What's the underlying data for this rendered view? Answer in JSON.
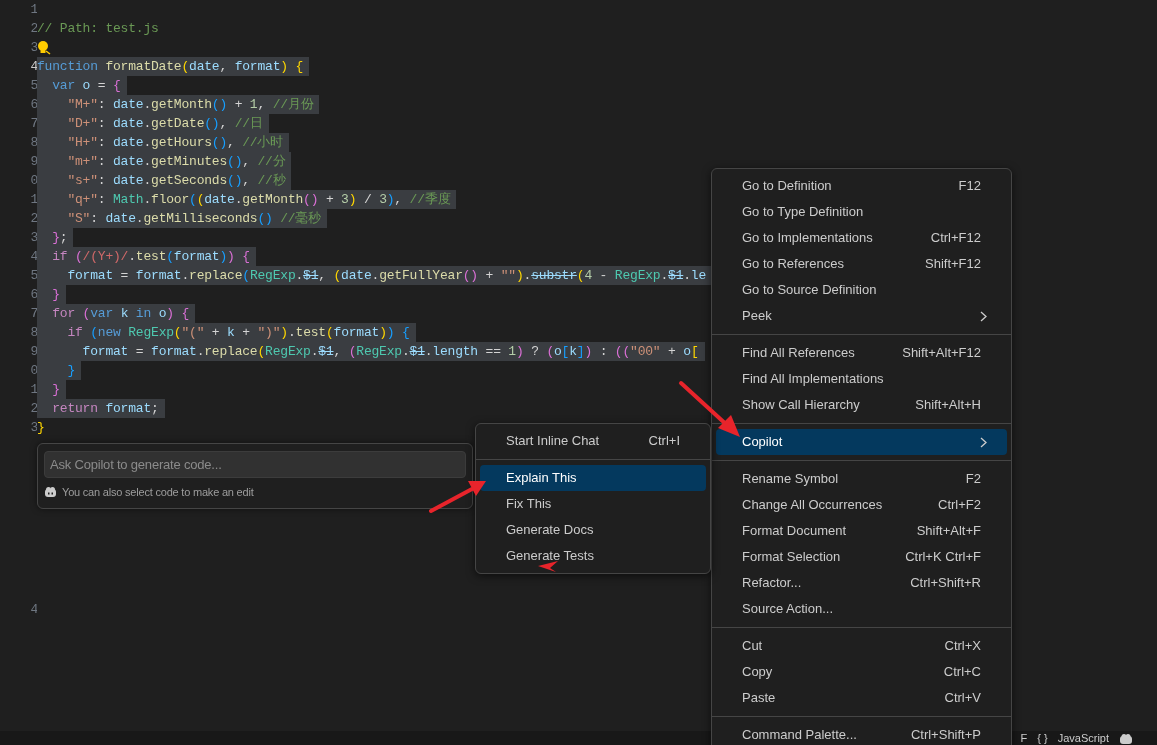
{
  "editor": {
    "lines": [
      {
        "number": "1",
        "kind": "blank",
        "selected": false,
        "active": false
      },
      {
        "number": "2",
        "kind": "code",
        "selected": false,
        "active": false,
        "tokens": [
          {
            "text": "// Path: test.js",
            "kind": "comment"
          }
        ]
      },
      {
        "number": "3",
        "kind": "lightbulb",
        "selected": false,
        "active": false
      },
      {
        "number": "4",
        "kind": "code",
        "selected": true,
        "active": true,
        "tokens": [
          {
            "text": "function",
            "kind": "keyword"
          },
          {
            "text": " formatDate",
            "kind": "fn"
          },
          {
            "text": "(",
            "kind": "b1"
          },
          {
            "text": "date",
            "kind": "var"
          },
          {
            "text": ", ",
            "kind": "plain"
          },
          {
            "text": "format",
            "kind": "var"
          },
          {
            "text": ")",
            "kind": "b1"
          },
          {
            "text": " {",
            "kind": "b1"
          }
        ]
      },
      {
        "number": "5",
        "kind": "code",
        "selected": true,
        "active": false,
        "tokens": [
          {
            "text": "  var",
            "kind": "keyword"
          },
          {
            "text": " o",
            "kind": "var"
          },
          {
            "text": " = ",
            "kind": "plain"
          },
          {
            "text": "{",
            "kind": "b2"
          }
        ]
      },
      {
        "number": "6",
        "kind": "code",
        "selected": true,
        "active": false,
        "tokens": [
          {
            "text": "    \"M+\"",
            "kind": "string"
          },
          {
            "text": ": ",
            "kind": "plain"
          },
          {
            "text": "date",
            "kind": "var"
          },
          {
            "text": ".",
            "kind": "plain"
          },
          {
            "text": "getMonth",
            "kind": "fn"
          },
          {
            "text": "()",
            "kind": "b3"
          },
          {
            "text": " + ",
            "kind": "plain"
          },
          {
            "text": "1",
            "kind": "number"
          },
          {
            "text": ", ",
            "kind": "plain"
          },
          {
            "text": "//月份",
            "kind": "comment"
          }
        ]
      },
      {
        "number": "7",
        "kind": "code",
        "selected": true,
        "active": false,
        "tokens": [
          {
            "text": "    \"D+\"",
            "kind": "string"
          },
          {
            "text": ": ",
            "kind": "plain"
          },
          {
            "text": "date",
            "kind": "var"
          },
          {
            "text": ".",
            "kind": "plain"
          },
          {
            "text": "getDate",
            "kind": "fn"
          },
          {
            "text": "()",
            "kind": "b3"
          },
          {
            "text": ", ",
            "kind": "plain"
          },
          {
            "text": "//日",
            "kind": "comment"
          }
        ]
      },
      {
        "number": "8",
        "kind": "code",
        "selected": true,
        "active": false,
        "tokens": [
          {
            "text": "    \"H+\"",
            "kind": "string"
          },
          {
            "text": ": ",
            "kind": "plain"
          },
          {
            "text": "date",
            "kind": "var"
          },
          {
            "text": ".",
            "kind": "plain"
          },
          {
            "text": "getHours",
            "kind": "fn"
          },
          {
            "text": "()",
            "kind": "b3"
          },
          {
            "text": ", ",
            "kind": "plain"
          },
          {
            "text": "//小时",
            "kind": "comment"
          }
        ]
      },
      {
        "number": "9",
        "kind": "code",
        "selected": true,
        "active": false,
        "tokens": [
          {
            "text": "    \"m+\"",
            "kind": "string"
          },
          {
            "text": ": ",
            "kind": "plain"
          },
          {
            "text": "date",
            "kind": "var"
          },
          {
            "text": ".",
            "kind": "plain"
          },
          {
            "text": "getMinutes",
            "kind": "fn"
          },
          {
            "text": "()",
            "kind": "b3"
          },
          {
            "text": ", ",
            "kind": "plain"
          },
          {
            "text": "//分",
            "kind": "comment"
          }
        ]
      },
      {
        "number": "0",
        "kind": "code",
        "selected": true,
        "active": false,
        "tokens": [
          {
            "text": "    \"s+\"",
            "kind": "string"
          },
          {
            "text": ": ",
            "kind": "plain"
          },
          {
            "text": "date",
            "kind": "var"
          },
          {
            "text": ".",
            "kind": "plain"
          },
          {
            "text": "getSeconds",
            "kind": "fn"
          },
          {
            "text": "()",
            "kind": "b3"
          },
          {
            "text": ", ",
            "kind": "plain"
          },
          {
            "text": "//秒",
            "kind": "comment"
          }
        ]
      },
      {
        "number": "1",
        "kind": "code",
        "selected": true,
        "active": false,
        "tokens": [
          {
            "text": "    \"q+\"",
            "kind": "string"
          },
          {
            "text": ": ",
            "kind": "plain"
          },
          {
            "text": "Math",
            "kind": "class"
          },
          {
            "text": ".",
            "kind": "plain"
          },
          {
            "text": "floor",
            "kind": "fn"
          },
          {
            "text": "(",
            "kind": "b3"
          },
          {
            "text": "(",
            "kind": "b1"
          },
          {
            "text": "date",
            "kind": "var"
          },
          {
            "text": ".",
            "kind": "plain"
          },
          {
            "text": "getMonth",
            "kind": "fn"
          },
          {
            "text": "()",
            "kind": "b2"
          },
          {
            "text": " + ",
            "kind": "plain"
          },
          {
            "text": "3",
            "kind": "number"
          },
          {
            "text": ")",
            "kind": "b1"
          },
          {
            "text": " / ",
            "kind": "plain"
          },
          {
            "text": "3",
            "kind": "number"
          },
          {
            "text": ")",
            "kind": "b3"
          },
          {
            "text": ", ",
            "kind": "plain"
          },
          {
            "text": "//季度",
            "kind": "comment"
          }
        ]
      },
      {
        "number": "2",
        "kind": "code",
        "selected": true,
        "active": false,
        "tokens": [
          {
            "text": "    \"S\"",
            "kind": "string"
          },
          {
            "text": ": ",
            "kind": "plain"
          },
          {
            "text": "date",
            "kind": "var"
          },
          {
            "text": ".",
            "kind": "plain"
          },
          {
            "text": "getMilliseconds",
            "kind": "fn"
          },
          {
            "text": "()",
            "kind": "b3"
          },
          {
            "text": " //毫秒",
            "kind": "comment"
          }
        ]
      },
      {
        "number": "3",
        "kind": "code",
        "selected": true,
        "active": false,
        "tokens": [
          {
            "text": "  }",
            "kind": "b2"
          },
          {
            "text": ";",
            "kind": "plain"
          }
        ]
      },
      {
        "number": "4",
        "kind": "code",
        "selected": true,
        "active": false,
        "tokens": [
          {
            "text": "  if",
            "kind": "control"
          },
          {
            "text": " (",
            "kind": "b2"
          },
          {
            "text": "/(Y+)/",
            "kind": "regex"
          },
          {
            "text": ".",
            "kind": "plain"
          },
          {
            "text": "test",
            "kind": "fn"
          },
          {
            "text": "(",
            "kind": "b3"
          },
          {
            "text": "format",
            "kind": "var"
          },
          {
            "text": ")",
            "kind": "b3"
          },
          {
            "text": ")",
            "kind": "b2"
          },
          {
            "text": " {",
            "kind": "b2"
          }
        ]
      },
      {
        "number": "5",
        "kind": "code",
        "selected": true,
        "active": false,
        "tokens": [
          {
            "text": "    format",
            "kind": "var"
          },
          {
            "text": " = ",
            "kind": "plain"
          },
          {
            "text": "format",
            "kind": "var"
          },
          {
            "text": ".",
            "kind": "plain"
          },
          {
            "text": "replace",
            "kind": "fn"
          },
          {
            "text": "(",
            "kind": "b3"
          },
          {
            "text": "RegExp",
            "kind": "class"
          },
          {
            "text": ".",
            "kind": "plain"
          },
          {
            "text": "$1",
            "kind": "deprecated"
          },
          {
            "text": ", ",
            "kind": "plain"
          },
          {
            "text": "(",
            "kind": "b1"
          },
          {
            "text": "date",
            "kind": "var"
          },
          {
            "text": ".",
            "kind": "plain"
          },
          {
            "text": "getFullYear",
            "kind": "fn"
          },
          {
            "text": "()",
            "kind": "b2"
          },
          {
            "text": " + ",
            "kind": "plain"
          },
          {
            "text": "\"\"",
            "kind": "string"
          },
          {
            "text": ")",
            "kind": "b1"
          },
          {
            "text": ".",
            "kind": "plain"
          },
          {
            "text": "substr",
            "kind": "deprecated"
          },
          {
            "text": "(",
            "kind": "b1"
          },
          {
            "text": "4",
            "kind": "number"
          },
          {
            "text": " - ",
            "kind": "plain"
          },
          {
            "text": "RegExp",
            "kind": "class"
          },
          {
            "text": ".",
            "kind": "plain"
          },
          {
            "text": "$1",
            "kind": "deprecated"
          },
          {
            "text": ".",
            "kind": "plain"
          },
          {
            "text": "le",
            "kind": "var"
          }
        ]
      },
      {
        "number": "6",
        "kind": "code",
        "selected": true,
        "active": false,
        "tokens": [
          {
            "text": "  }",
            "kind": "b2"
          }
        ]
      },
      {
        "number": "7",
        "kind": "code",
        "selected": true,
        "active": false,
        "tokens": [
          {
            "text": "  for",
            "kind": "control"
          },
          {
            "text": " (",
            "kind": "b2"
          },
          {
            "text": "var",
            "kind": "keyword"
          },
          {
            "text": " k",
            "kind": "var"
          },
          {
            "text": " in",
            "kind": "keyword"
          },
          {
            "text": " o",
            "kind": "var"
          },
          {
            "text": ")",
            "kind": "b2"
          },
          {
            "text": " {",
            "kind": "b2"
          }
        ]
      },
      {
        "number": "8",
        "kind": "code",
        "selected": true,
        "active": false,
        "tokens": [
          {
            "text": "    if",
            "kind": "control"
          },
          {
            "text": " (",
            "kind": "b3"
          },
          {
            "text": "new",
            "kind": "keyword"
          },
          {
            "text": " RegExp",
            "kind": "class"
          },
          {
            "text": "(",
            "kind": "b1"
          },
          {
            "text": "\"(\"",
            "kind": "string"
          },
          {
            "text": " + ",
            "kind": "plain"
          },
          {
            "text": "k",
            "kind": "var"
          },
          {
            "text": " + ",
            "kind": "plain"
          },
          {
            "text": "\")\"",
            "kind": "string"
          },
          {
            "text": ")",
            "kind": "b1"
          },
          {
            "text": ".",
            "kind": "plain"
          },
          {
            "text": "test",
            "kind": "fn"
          },
          {
            "text": "(",
            "kind": "b1"
          },
          {
            "text": "format",
            "kind": "var"
          },
          {
            "text": ")",
            "kind": "b1"
          },
          {
            "text": ")",
            "kind": "b3"
          },
          {
            "text": " {",
            "kind": "b3"
          }
        ]
      },
      {
        "number": "9",
        "kind": "code",
        "selected": true,
        "active": false,
        "tokens": [
          {
            "text": "      format",
            "kind": "var"
          },
          {
            "text": " = ",
            "kind": "plain"
          },
          {
            "text": "format",
            "kind": "var"
          },
          {
            "text": ".",
            "kind": "plain"
          },
          {
            "text": "replace",
            "kind": "fn"
          },
          {
            "text": "(",
            "kind": "b1"
          },
          {
            "text": "RegExp",
            "kind": "class"
          },
          {
            "text": ".",
            "kind": "plain"
          },
          {
            "text": "$1",
            "kind": "deprecated"
          },
          {
            "text": ", ",
            "kind": "plain"
          },
          {
            "text": "(",
            "kind": "b2"
          },
          {
            "text": "RegExp",
            "kind": "class"
          },
          {
            "text": ".",
            "kind": "plain"
          },
          {
            "text": "$1",
            "kind": "deprecated"
          },
          {
            "text": ".",
            "kind": "plain"
          },
          {
            "text": "length",
            "kind": "var"
          },
          {
            "text": " == ",
            "kind": "plain"
          },
          {
            "text": "1",
            "kind": "number"
          },
          {
            "text": ")",
            "kind": "b2"
          },
          {
            "text": " ? ",
            "kind": "plain"
          },
          {
            "text": "(",
            "kind": "b2"
          },
          {
            "text": "o",
            "kind": "var"
          },
          {
            "text": "[",
            "kind": "b3"
          },
          {
            "text": "k",
            "kind": "var"
          },
          {
            "text": "]",
            "kind": "b3"
          },
          {
            "text": ")",
            "kind": "b2"
          },
          {
            "text": " : ",
            "kind": "plain"
          },
          {
            "text": "((",
            "kind": "b2"
          },
          {
            "text": "\"00\"",
            "kind": "string"
          },
          {
            "text": " + ",
            "kind": "plain"
          },
          {
            "text": "o",
            "kind": "var"
          },
          {
            "text": "[",
            "kind": "b1"
          }
        ]
      },
      {
        "number": "0",
        "kind": "code",
        "selected": true,
        "active": false,
        "tokens": [
          {
            "text": "    }",
            "kind": "b3"
          }
        ]
      },
      {
        "number": "1",
        "kind": "code",
        "selected": true,
        "active": false,
        "tokens": [
          {
            "text": "  }",
            "kind": "b2"
          }
        ]
      },
      {
        "number": "2",
        "kind": "code",
        "selected": true,
        "active": false,
        "tokens": [
          {
            "text": "  return",
            "kind": "control"
          },
          {
            "text": " format",
            "kind": "var"
          },
          {
            "text": ";",
            "kind": "plain"
          }
        ]
      },
      {
        "number": "3",
        "kind": "code",
        "selected": false,
        "active": false,
        "tokens": [
          {
            "text": "}",
            "kind": "b1"
          }
        ]
      },
      {
        "number": "4",
        "kind": "blank",
        "selected": false,
        "active": false
      }
    ]
  },
  "inline_chat": {
    "placeholder": "Ask Copilot to generate code...",
    "hint": "You can also select code to make an edit"
  },
  "context_menu": {
    "groups": [
      [
        {
          "label": "Go to Definition",
          "shortcut": "F12",
          "submenu": false,
          "selected": false
        },
        {
          "label": "Go to Type Definition",
          "submenu": false,
          "selected": false
        },
        {
          "label": "Go to Implementations",
          "shortcut": "Ctrl+F12",
          "submenu": false,
          "selected": false
        },
        {
          "label": "Go to References",
          "shortcut": "Shift+F12",
          "submenu": false,
          "selected": false
        },
        {
          "label": "Go to Source Definition",
          "submenu": false,
          "selected": false
        },
        {
          "label": "Peek",
          "submenu": true,
          "selected": false
        }
      ],
      [
        {
          "label": "Find All References",
          "shortcut": "Shift+Alt+F12",
          "submenu": false,
          "selected": false
        },
        {
          "label": "Find All Implementations",
          "submenu": false,
          "selected": false
        },
        {
          "label": "Show Call Hierarchy",
          "shortcut": "Shift+Alt+H",
          "submenu": false,
          "selected": false
        }
      ],
      [
        {
          "label": "Copilot",
          "submenu": true,
          "selected": true
        }
      ],
      [
        {
          "label": "Rename Symbol",
          "shortcut": "F2",
          "submenu": false,
          "selected": false
        },
        {
          "label": "Change All Occurrences",
          "shortcut": "Ctrl+F2",
          "submenu": false,
          "selected": false
        },
        {
          "label": "Format Document",
          "shortcut": "Shift+Alt+F",
          "submenu": false,
          "selected": false
        },
        {
          "label": "Format Selection",
          "shortcut": "Ctrl+K Ctrl+F",
          "submenu": false,
          "selected": false
        },
        {
          "label": "Refactor...",
          "shortcut": "Ctrl+Shift+R",
          "submenu": false,
          "selected": false
        },
        {
          "label": "Source Action...",
          "submenu": false,
          "selected": false
        }
      ],
      [
        {
          "label": "Cut",
          "shortcut": "Ctrl+X",
          "submenu": false,
          "selected": false
        },
        {
          "label": "Copy",
          "shortcut": "Ctrl+C",
          "submenu": false,
          "selected": false
        },
        {
          "label": "Paste",
          "shortcut": "Ctrl+V",
          "submenu": false,
          "selected": false
        }
      ],
      [
        {
          "label": "Command Palette...",
          "shortcut": "Ctrl+Shift+P",
          "submenu": false,
          "selected": false
        }
      ]
    ]
  },
  "copilot_submenu": {
    "groups": [
      [
        {
          "label": "Start Inline Chat",
          "shortcut": "Ctrl+I",
          "selected": false
        }
      ],
      [
        {
          "label": "Explain This",
          "selected": true
        },
        {
          "label": "Fix This",
          "selected": false
        },
        {
          "label": "Generate Docs",
          "selected": false
        },
        {
          "label": "Generate Tests",
          "selected": false
        }
      ]
    ]
  },
  "status_bar": {
    "items": [
      {
        "text": "F"
      },
      {
        "text": "{ }"
      },
      {
        "text": "JavaScript"
      }
    ]
  }
}
